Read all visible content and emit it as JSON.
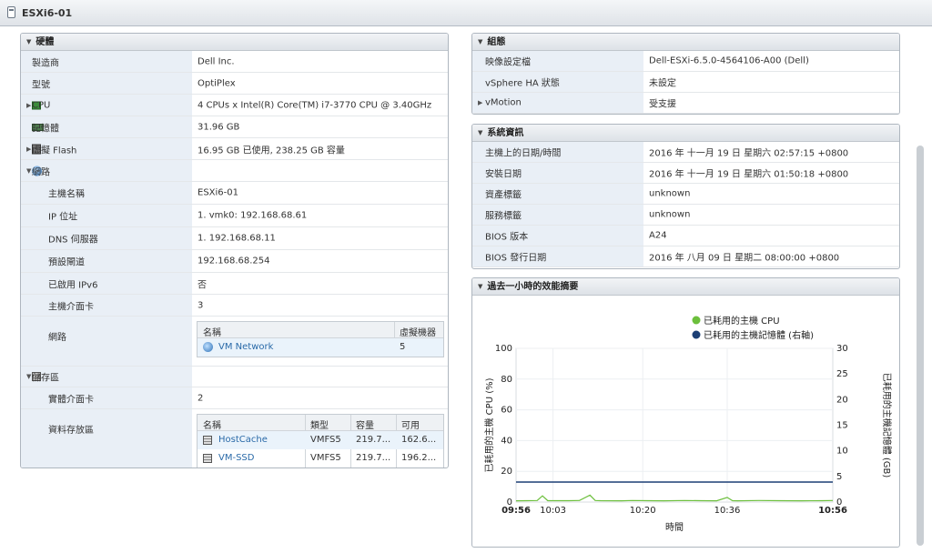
{
  "window": {
    "title": "ESXi6-01"
  },
  "hardware": {
    "header": "硬體",
    "rows": [
      {
        "label": "製造商",
        "value": "Dell Inc."
      },
      {
        "label": "型號",
        "value": "OptiPlex"
      },
      {
        "label": "CPU",
        "value": "4 CPUs x Intel(R) Core(TM) i7-3770 CPU @ 3.40GHz"
      },
      {
        "label": "記憶體",
        "value": "31.96 GB"
      },
      {
        "label": "虛擬 Flash",
        "value": "16.95 GB 已使用, 238.25 GB 容量"
      },
      {
        "label": "網路",
        "value": ""
      },
      {
        "label": "主機名稱",
        "value": "ESXi6-01"
      },
      {
        "label": "IP 位址",
        "value": "1. vmk0: 192.168.68.61"
      },
      {
        "label": "DNS 伺服器",
        "value": "1. 192.168.68.11"
      },
      {
        "label": "預設閘道",
        "value": "192.168.68.254"
      },
      {
        "label": "已啟用 IPv6",
        "value": "否"
      },
      {
        "label": "主機介面卡",
        "value": "3"
      },
      {
        "label": "網路",
        "value": ""
      },
      {
        "label": "儲存區",
        "value": ""
      },
      {
        "label": "實體介面卡",
        "value": "2"
      },
      {
        "label": "資料存放區",
        "value": ""
      }
    ],
    "network_table": {
      "headers": [
        "名稱",
        "虛擬機器"
      ],
      "rows": [
        {
          "name": "VM Network",
          "vms": "5"
        }
      ]
    },
    "datastore_table": {
      "headers": [
        "名稱",
        "類型",
        "容量",
        "可用"
      ],
      "rows": [
        {
          "name": "HostCache",
          "type": "VMFS5",
          "capacity": "219.7...",
          "free": "162.6..."
        },
        {
          "name": "VM-SSD",
          "type": "VMFS5",
          "capacity": "219.7...",
          "free": "196.2..."
        }
      ]
    }
  },
  "configuration": {
    "header": "組態",
    "rows": [
      {
        "label": "映像設定檔",
        "value": "Dell-ESXi-6.5.0-4564106-A00 (Dell)"
      },
      {
        "label": "vSphere HA 狀態",
        "value": "未設定"
      },
      {
        "label": "vMotion",
        "value": "受支援"
      }
    ]
  },
  "system_info": {
    "header": "系統資訊",
    "rows": [
      {
        "label": "主機上的日期/時間",
        "value": "2016 年 十一月 19 日 星期六 02:57:15 +0800"
      },
      {
        "label": "安裝日期",
        "value": "2016 年 十一月 19 日 星期六 01:50:18 +0800"
      },
      {
        "label": "資產標籤",
        "value": "unknown"
      },
      {
        "label": "服務標籤",
        "value": "unknown"
      },
      {
        "label": "BIOS 版本",
        "value": "A24"
      },
      {
        "label": "BIOS 發行日期",
        "value": "2016 年 八月 09 日 星期二 08:00:00 +0800"
      }
    ]
  },
  "perf": {
    "header": "過去一小時的效能摘要"
  },
  "colors": {
    "cpu": "#6cbf3c",
    "memory": "#1c3f75",
    "label_bg": "#e9eff6",
    "link": "#2a6aa8"
  },
  "icons": [
    "collapse-triangle-icon",
    "cpu-icon",
    "memory-icon",
    "flash-icon",
    "network-globe-icon",
    "storage-disk-icon",
    "datastore-icon",
    "host-icon"
  ],
  "chart_data": {
    "type": "line",
    "x_label": "時間",
    "y_label_left": "已耗用的主機 CPU (%)",
    "y_label_right": "已耗用的主機記憶體 (GB)",
    "x_ticks": [
      "09:56",
      "10:03",
      "10:20",
      "10:36",
      "10:56"
    ],
    "x_minutes": [
      0,
      7,
      24,
      40,
      60
    ],
    "y_left_ticks": [
      "0",
      "20",
      "40",
      "60",
      "80",
      "100"
    ],
    "y_right_ticks": [
      "0",
      "5",
      "10",
      "15",
      "20",
      "25",
      "30"
    ],
    "ylim_left": [
      0,
      100
    ],
    "ylim_right": [
      0,
      30
    ],
    "legend_position": "top",
    "grid": true,
    "series": [
      {
        "name": "已耗用的主機 CPU",
        "axis": "left",
        "color": "#6cbf3c",
        "x": [
          0,
          2,
          4,
          5,
          6,
          10,
          12,
          14,
          15,
          16,
          20,
          22,
          25,
          28,
          32,
          35,
          38,
          40,
          41,
          42,
          46,
          50,
          54,
          58,
          60
        ],
        "y": [
          0.8,
          0.9,
          1.0,
          4.0,
          0.9,
          0.9,
          1.0,
          4.5,
          1.0,
          0.9,
          0.8,
          1.0,
          0.9,
          0.8,
          1.0,
          0.9,
          0.8,
          3.0,
          0.9,
          0.8,
          1.0,
          0.9,
          0.8,
          0.9,
          1.0
        ]
      },
      {
        "name": "已耗用的主機記憶體 (右軸)",
        "axis": "right",
        "color": "#1c3f75",
        "x": [
          0,
          60
        ],
        "y": [
          3.9,
          3.9
        ]
      }
    ]
  }
}
